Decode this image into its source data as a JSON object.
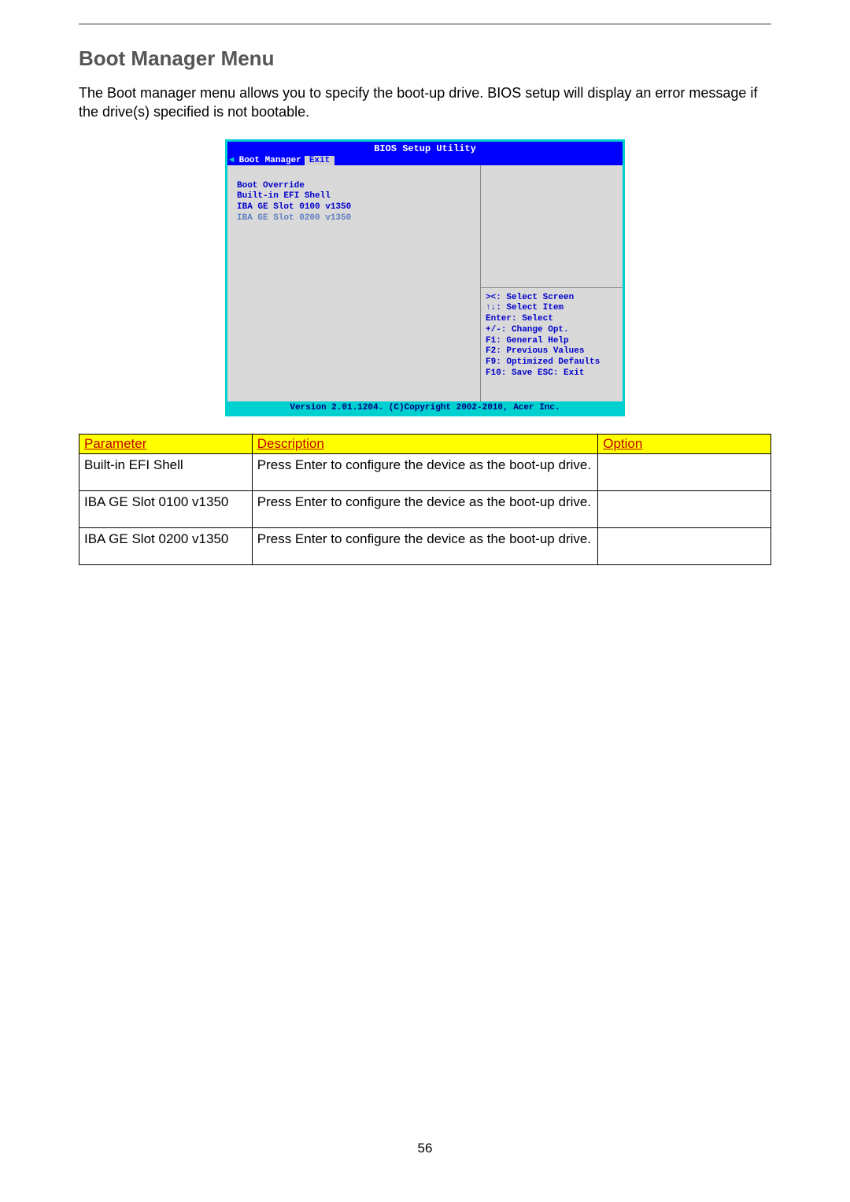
{
  "heading": "Boot Manager Menu",
  "intro": "The Boot manager menu allows you to specify the boot-up drive. BIOS setup will display an error message if the drive(s) specified is not bootable.",
  "bios": {
    "title": "BIOS Setup Utility",
    "tabs": {
      "arrow": "◄",
      "selected": "Boot Manager",
      "other": "Exit"
    },
    "left_items": {
      "l1": "Boot Override",
      "l2": "Built-in EFI Shell",
      "l3": "IBA GE Slot 0100 v1350",
      "l4": "IBA GE Slot 0200 v1350"
    },
    "help": {
      "h1": "><: Select Screen",
      "h2": "↑↓: Select Item",
      "h3": "Enter: Select",
      "h4": "+/-: Change Opt.",
      "h5": "F1: General Help",
      "h6": "F2: Previous Values",
      "h7": "F9: Optimized Defaults",
      "h8": "F10: Save  ESC: Exit"
    },
    "footer": "Version 2.01.1204. (C)Copyright 2002-2010, Acer Inc."
  },
  "table": {
    "headers": {
      "param": "Parameter",
      "desc": "Description",
      "opt": "Option"
    },
    "rows": [
      {
        "param": "Built-in EFI Shell",
        "desc": "Press Enter to configure the device as the boot-up drive.",
        "opt": ""
      },
      {
        "param": "IBA GE Slot 0100 v1350",
        "desc": "Press Enter to configure the device as the boot-up drive.",
        "opt": ""
      },
      {
        "param": "IBA GE Slot 0200 v1350",
        "desc": "Press Enter to configure the device as the boot-up drive.",
        "opt": ""
      }
    ]
  },
  "page_number": "56"
}
